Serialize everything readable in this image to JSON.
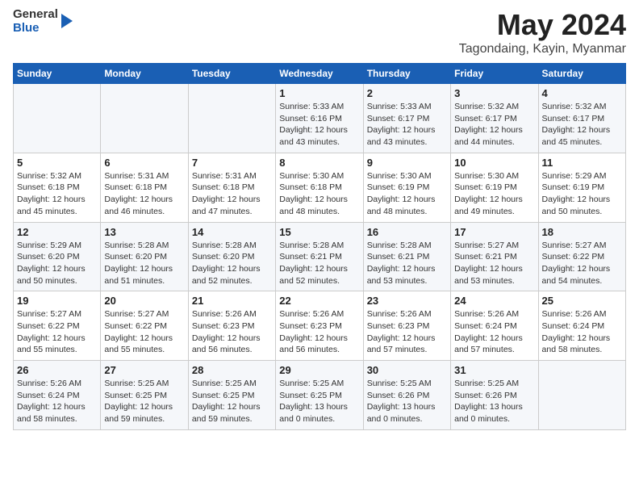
{
  "logo": {
    "general": "General",
    "blue": "Blue"
  },
  "title": "May 2024",
  "subtitle": "Tagondaing, Kayin, Myanmar",
  "days_header": [
    "Sunday",
    "Monday",
    "Tuesday",
    "Wednesday",
    "Thursday",
    "Friday",
    "Saturday"
  ],
  "weeks": [
    [
      {
        "day": "",
        "sunrise": "",
        "sunset": "",
        "daylight": ""
      },
      {
        "day": "",
        "sunrise": "",
        "sunset": "",
        "daylight": ""
      },
      {
        "day": "",
        "sunrise": "",
        "sunset": "",
        "daylight": ""
      },
      {
        "day": "1",
        "sunrise": "Sunrise: 5:33 AM",
        "sunset": "Sunset: 6:16 PM",
        "daylight": "Daylight: 12 hours and 43 minutes."
      },
      {
        "day": "2",
        "sunrise": "Sunrise: 5:33 AM",
        "sunset": "Sunset: 6:17 PM",
        "daylight": "Daylight: 12 hours and 43 minutes."
      },
      {
        "day": "3",
        "sunrise": "Sunrise: 5:32 AM",
        "sunset": "Sunset: 6:17 PM",
        "daylight": "Daylight: 12 hours and 44 minutes."
      },
      {
        "day": "4",
        "sunrise": "Sunrise: 5:32 AM",
        "sunset": "Sunset: 6:17 PM",
        "daylight": "Daylight: 12 hours and 45 minutes."
      }
    ],
    [
      {
        "day": "5",
        "sunrise": "Sunrise: 5:32 AM",
        "sunset": "Sunset: 6:18 PM",
        "daylight": "Daylight: 12 hours and 45 minutes."
      },
      {
        "day": "6",
        "sunrise": "Sunrise: 5:31 AM",
        "sunset": "Sunset: 6:18 PM",
        "daylight": "Daylight: 12 hours and 46 minutes."
      },
      {
        "day": "7",
        "sunrise": "Sunrise: 5:31 AM",
        "sunset": "Sunset: 6:18 PM",
        "daylight": "Daylight: 12 hours and 47 minutes."
      },
      {
        "day": "8",
        "sunrise": "Sunrise: 5:30 AM",
        "sunset": "Sunset: 6:18 PM",
        "daylight": "Daylight: 12 hours and 48 minutes."
      },
      {
        "day": "9",
        "sunrise": "Sunrise: 5:30 AM",
        "sunset": "Sunset: 6:19 PM",
        "daylight": "Daylight: 12 hours and 48 minutes."
      },
      {
        "day": "10",
        "sunrise": "Sunrise: 5:30 AM",
        "sunset": "Sunset: 6:19 PM",
        "daylight": "Daylight: 12 hours and 49 minutes."
      },
      {
        "day": "11",
        "sunrise": "Sunrise: 5:29 AM",
        "sunset": "Sunset: 6:19 PM",
        "daylight": "Daylight: 12 hours and 50 minutes."
      }
    ],
    [
      {
        "day": "12",
        "sunrise": "Sunrise: 5:29 AM",
        "sunset": "Sunset: 6:20 PM",
        "daylight": "Daylight: 12 hours and 50 minutes."
      },
      {
        "day": "13",
        "sunrise": "Sunrise: 5:28 AM",
        "sunset": "Sunset: 6:20 PM",
        "daylight": "Daylight: 12 hours and 51 minutes."
      },
      {
        "day": "14",
        "sunrise": "Sunrise: 5:28 AM",
        "sunset": "Sunset: 6:20 PM",
        "daylight": "Daylight: 12 hours and 52 minutes."
      },
      {
        "day": "15",
        "sunrise": "Sunrise: 5:28 AM",
        "sunset": "Sunset: 6:21 PM",
        "daylight": "Daylight: 12 hours and 52 minutes."
      },
      {
        "day": "16",
        "sunrise": "Sunrise: 5:28 AM",
        "sunset": "Sunset: 6:21 PM",
        "daylight": "Daylight: 12 hours and 53 minutes."
      },
      {
        "day": "17",
        "sunrise": "Sunrise: 5:27 AM",
        "sunset": "Sunset: 6:21 PM",
        "daylight": "Daylight: 12 hours and 53 minutes."
      },
      {
        "day": "18",
        "sunrise": "Sunrise: 5:27 AM",
        "sunset": "Sunset: 6:22 PM",
        "daylight": "Daylight: 12 hours and 54 minutes."
      }
    ],
    [
      {
        "day": "19",
        "sunrise": "Sunrise: 5:27 AM",
        "sunset": "Sunset: 6:22 PM",
        "daylight": "Daylight: 12 hours and 55 minutes."
      },
      {
        "day": "20",
        "sunrise": "Sunrise: 5:27 AM",
        "sunset": "Sunset: 6:22 PM",
        "daylight": "Daylight: 12 hours and 55 minutes."
      },
      {
        "day": "21",
        "sunrise": "Sunrise: 5:26 AM",
        "sunset": "Sunset: 6:23 PM",
        "daylight": "Daylight: 12 hours and 56 minutes."
      },
      {
        "day": "22",
        "sunrise": "Sunrise: 5:26 AM",
        "sunset": "Sunset: 6:23 PM",
        "daylight": "Daylight: 12 hours and 56 minutes."
      },
      {
        "day": "23",
        "sunrise": "Sunrise: 5:26 AM",
        "sunset": "Sunset: 6:23 PM",
        "daylight": "Daylight: 12 hours and 57 minutes."
      },
      {
        "day": "24",
        "sunrise": "Sunrise: 5:26 AM",
        "sunset": "Sunset: 6:24 PM",
        "daylight": "Daylight: 12 hours and 57 minutes."
      },
      {
        "day": "25",
        "sunrise": "Sunrise: 5:26 AM",
        "sunset": "Sunset: 6:24 PM",
        "daylight": "Daylight: 12 hours and 58 minutes."
      }
    ],
    [
      {
        "day": "26",
        "sunrise": "Sunrise: 5:26 AM",
        "sunset": "Sunset: 6:24 PM",
        "daylight": "Daylight: 12 hours and 58 minutes."
      },
      {
        "day": "27",
        "sunrise": "Sunrise: 5:25 AM",
        "sunset": "Sunset: 6:25 PM",
        "daylight": "Daylight: 12 hours and 59 minutes."
      },
      {
        "day": "28",
        "sunrise": "Sunrise: 5:25 AM",
        "sunset": "Sunset: 6:25 PM",
        "daylight": "Daylight: 12 hours and 59 minutes."
      },
      {
        "day": "29",
        "sunrise": "Sunrise: 5:25 AM",
        "sunset": "Sunset: 6:25 PM",
        "daylight": "Daylight: 13 hours and 0 minutes."
      },
      {
        "day": "30",
        "sunrise": "Sunrise: 5:25 AM",
        "sunset": "Sunset: 6:26 PM",
        "daylight": "Daylight: 13 hours and 0 minutes."
      },
      {
        "day": "31",
        "sunrise": "Sunrise: 5:25 AM",
        "sunset": "Sunset: 6:26 PM",
        "daylight": "Daylight: 13 hours and 0 minutes."
      },
      {
        "day": "",
        "sunrise": "",
        "sunset": "",
        "daylight": ""
      }
    ]
  ]
}
